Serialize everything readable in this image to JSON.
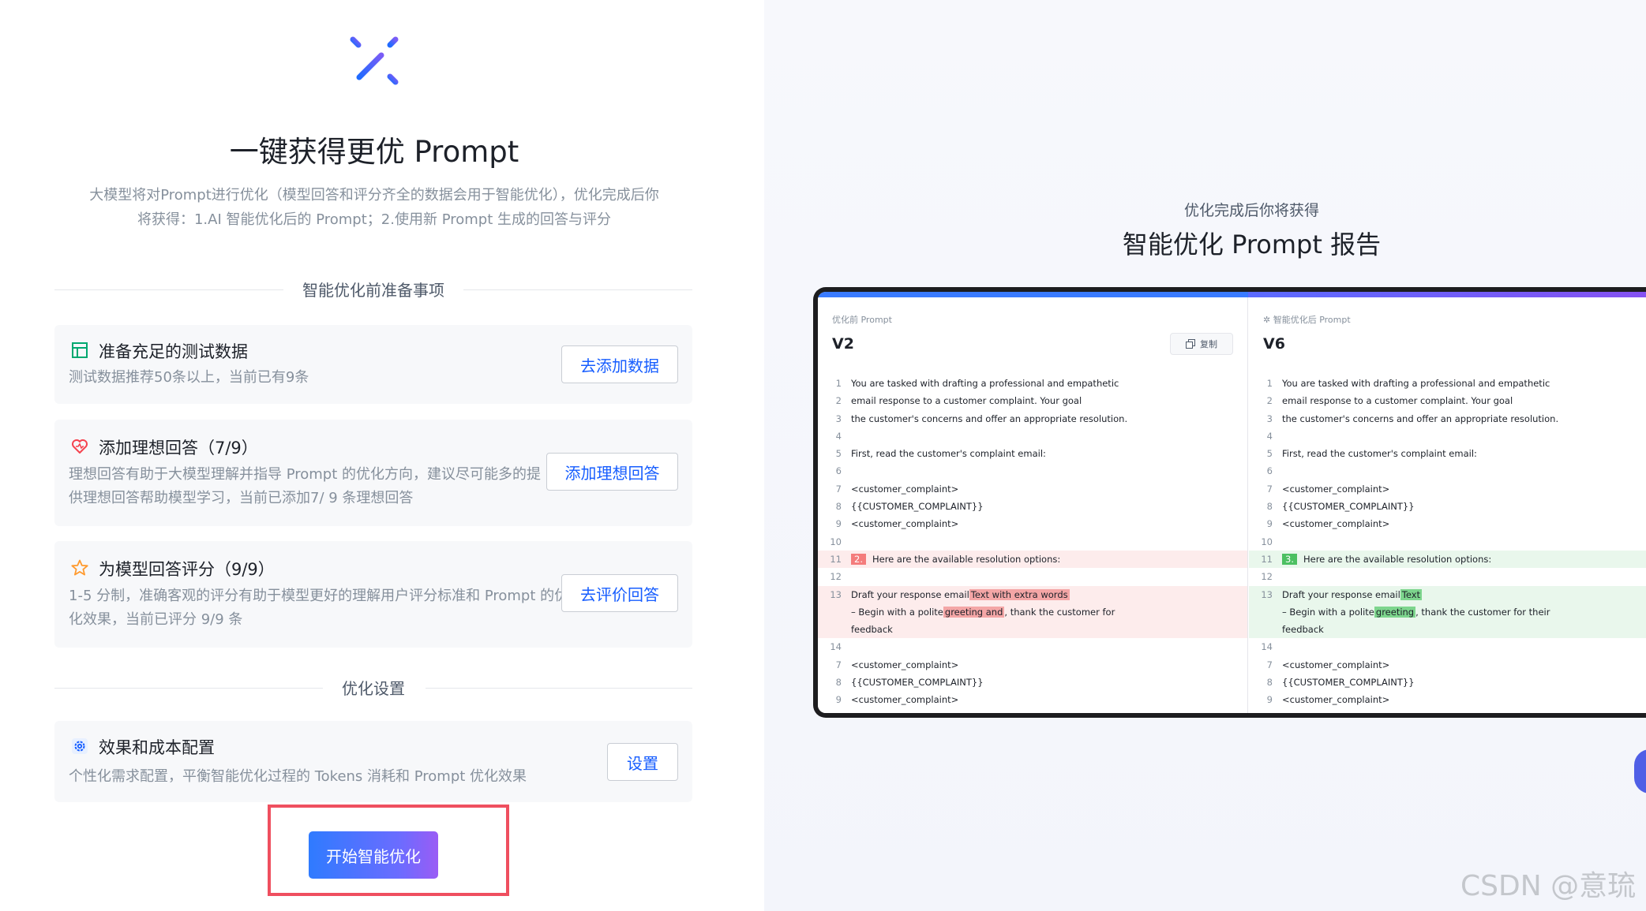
{
  "hero": {
    "title": "一键获得更优 Prompt",
    "desc_line1": "大模型将对Prompt进行优化（模型回答和评分齐全的数据会用于智能优化），优化完成后你",
    "desc_line2": "将获得：1.AI 智能优化后的 Prompt；2.使用新 Prompt 生成的回答与评分"
  },
  "prep_section": {
    "label": "智能优化前准备事项"
  },
  "cards": [
    {
      "icon": "table-icon",
      "title": "准备充足的测试数据",
      "desc_line1": "测试数据推荐50条以上，当前已有9条",
      "desc_line2": "",
      "button": "去添加数据"
    },
    {
      "icon": "heart-icon",
      "title": "添加理想回答（7/9）",
      "desc_line1": "理想回答有助于大模型理解并指导 Prompt 的优化方向，建议尽可能多的提",
      "desc_line2": "供理想回答帮助模型学习，当前已添加7/ 9 条理想回答",
      "button": "添加理想回答"
    },
    {
      "icon": "star-icon",
      "title": "为模型回答评分（9/9）",
      "desc_line1": "1-5 分制，准确客观的评分有助于模型更好的理解用户评分标准和 Prompt 的优",
      "desc_line2": "化效果，当前已评分 9/9 条",
      "button": "去评价回答"
    }
  ],
  "settings_section": {
    "label": "优化设置"
  },
  "settings_card": {
    "icon": "gear-icon",
    "title": "效果和成本配置",
    "desc": "个性化需求配置，平衡智能优化过程的 Tokens 消耗和 Prompt 优化效果",
    "button": "设置"
  },
  "start_button": "开始智能优化",
  "report": {
    "subtitle": "优化完成后你将获得",
    "title": "智能优化 Prompt 报告",
    "before": {
      "label": "优化前 Prompt",
      "version": "V2",
      "copy": "复制",
      "lines": [
        {
          "n": "1",
          "t": "You are tasked with drafting a professional and empathetic"
        },
        {
          "n": "2",
          "t": "email response to a customer complaint. Your goal"
        },
        {
          "n": "3",
          "t": "the customer's concerns and offer an appropriate resolution."
        },
        {
          "n": "4",
          "t": ""
        },
        {
          "n": "5",
          "t": "First, read the customer's complaint email:"
        },
        {
          "n": "6",
          "t": ""
        },
        {
          "n": "7",
          "t": "<customer_complaint>"
        },
        {
          "n": "8",
          "t": "{{CUSTOMER_COMPLAINT}}"
        },
        {
          "n": "9",
          "t": "<customer_complaint>"
        },
        {
          "n": "10",
          "t": ""
        }
      ],
      "line11_num": "11",
      "line11_badge": "2.",
      "line11_text": "Here are the available resolution options:",
      "line12_num": "12",
      "line13_num": "13",
      "line13_a": "Draft your response email",
      "line13_mark": "Text with extra words",
      "line13b_a": "– Begin with a polite",
      "line13b_mark": "greeting and",
      "line13b_c": ", thank the customer for",
      "line13c": "feedback",
      "tail": [
        {
          "n": "14",
          "t": ""
        },
        {
          "n": "7",
          "t": "<customer_complaint>"
        },
        {
          "n": "8",
          "t": "{{CUSTOMER_COMPLAINT}}"
        },
        {
          "n": "9",
          "t": "<customer_complaint>"
        }
      ]
    },
    "after": {
      "label": "智能优化后 Prompt",
      "version": "V6",
      "lines": [
        {
          "n": "1",
          "t": "You are tasked with drafting a professional and empathetic"
        },
        {
          "n": "2",
          "t": "email response to a customer complaint. Your goal"
        },
        {
          "n": "3",
          "t": "the customer's concerns and offer an appropriate resolution."
        },
        {
          "n": "4",
          "t": ""
        },
        {
          "n": "5",
          "t": "First, read the customer's complaint email:"
        },
        {
          "n": "6",
          "t": ""
        },
        {
          "n": "7",
          "t": "<customer_complaint>"
        },
        {
          "n": "8",
          "t": "{{CUSTOMER_COMPLAINT}}"
        },
        {
          "n": "9",
          "t": "<customer_complaint>"
        },
        {
          "n": "10",
          "t": ""
        }
      ],
      "line11_num": "11",
      "line11_badge": "3.",
      "line11_text": "Here are the available resolution options:",
      "line12_num": "12",
      "line13_num": "13",
      "line13_a": "Draft your response email",
      "line13_mark": "Text",
      "line13b_a": "– Begin with a polite",
      "line13b_mark": "greeting",
      "line13b_c": ", thank the customer for their",
      "line13c": "feedback",
      "tail": [
        {
          "n": "14",
          "t": ""
        },
        {
          "n": "7",
          "t": "<customer_complaint>"
        },
        {
          "n": "8",
          "t": "{{CUSTOMER_COMPLAINT}}"
        },
        {
          "n": "9",
          "t": "<customer_complaint>"
        }
      ]
    }
  },
  "watermark": "CSDN @意琉",
  "colors": {
    "accent": "#165dff",
    "gradient_start": "#2f7bff",
    "gradient_end": "#9a5cf5",
    "highlight_outline": "#ef4f5f"
  }
}
